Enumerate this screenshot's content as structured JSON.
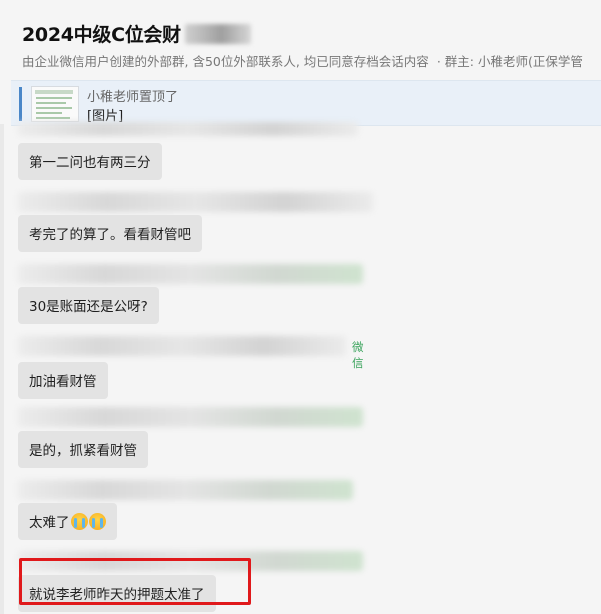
{
  "header": {
    "title": "2024中级C位会财",
    "subtitle": "由企业微信用户创建的外部群, 含50位外部联系人, 均已同意存档会话内容",
    "owner": "· 群主: 小稚老师(正保学管"
  },
  "pinned": {
    "text": "小稚老师置顶了",
    "content": "[图片]"
  },
  "messages": [
    {
      "sender_tag": "",
      "text": "第一二问也有两三分"
    },
    {
      "sender_tag": "",
      "text": "考完了的算了。看看财管吧"
    },
    {
      "sender_tag": "",
      "text": "30是账面还是公呀?"
    },
    {
      "sender_tag": "微信",
      "text": "加油看财管"
    },
    {
      "sender_tag": "",
      "text": "是的，抓紧看财管"
    },
    {
      "sender_tag": "",
      "text": "太难了"
    },
    {
      "sender_tag": "",
      "text": "就说李老师昨天的押题太准了"
    }
  ],
  "emoji": [
    "loudly-crying-face",
    "loudly-crying-face"
  ],
  "colors": {
    "background": "#f5f5f5",
    "bubble": "#e3e3e3",
    "pinned_bg": "#e9f0f8",
    "pinned_bar": "#4a87c8",
    "wechat_tag": "#3aa35c",
    "highlight_box": "#e0191b"
  }
}
